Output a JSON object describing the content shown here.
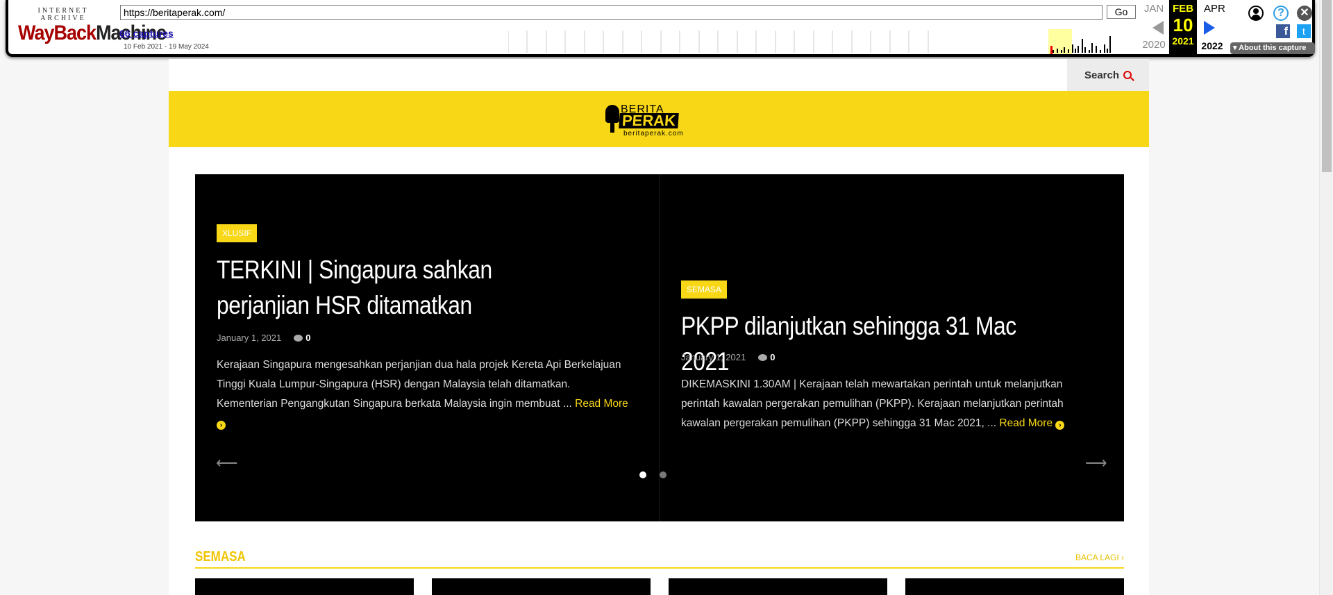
{
  "wayback": {
    "logo_top": "INTERNET ARCHIVE",
    "logo_brand_a": "WayBack",
    "logo_brand_b": "Machine",
    "url": "https://beritaperak.com/",
    "go_label": "Go",
    "captures_link": "66 captures",
    "date_range": "10 Feb 2021 - 19 May 2024",
    "prev_month": "JAN",
    "prev_year": "2020",
    "current_month": "FEB",
    "current_day": "10",
    "current_year": "2021",
    "next_month": "APR",
    "next_year": "2022",
    "about_label": "About this capture",
    "help_glyph": "?",
    "close_glyph": "✕",
    "facebook_glyph": "f",
    "twitter_glyph": "t",
    "icons": [
      "user-icon",
      "help-icon",
      "close-icon",
      "facebook-icon",
      "twitter-icon",
      "prev-arrow-icon",
      "next-arrow-icon"
    ]
  },
  "site": {
    "search_label": "Search",
    "logo": {
      "line1": "BERITA",
      "line2": "PERAK",
      "line3": "beritaperak.com"
    },
    "accent_color": "#f8d717",
    "slides": [
      {
        "category": "XLUSIF",
        "title": "TERKINI | Singapura sahkan perjanjian HSR ditamatkan",
        "date": "January 1, 2021",
        "comments": "0",
        "excerpt": "Kerajaan Singapura mengesahkan perjanjian dua hala projek Kereta Api Berkelajuan Tinggi Kuala Lumpur-Singapura (HSR) dengan Malaysia telah ditamatkan. Kementerian Pengangkutan Singapura berkata Malaysia ingin membuat ... ",
        "read_more": "Read More"
      },
      {
        "category": "SEMASA",
        "title": "PKPP dilanjutkan sehingga 31 Mac 2021",
        "date": "January 1, 2021",
        "comments": "0",
        "excerpt": "DIKEMASKINI 1.30AM | Kerajaan telah mewartakan perintah untuk melanjutkan perintah kawalan pergerakan pemulihan (PKPP). Kerajaan melanjutkan perintah kawalan pergerakan pemulihan (PKPP) sehingga 31 Mac 2021, ... ",
        "read_more": "Read More"
      }
    ],
    "prev_arrow": "⟵",
    "next_arrow": "⟶",
    "section": {
      "title": "SEMASA",
      "more": "BACA LAGI ›"
    }
  }
}
